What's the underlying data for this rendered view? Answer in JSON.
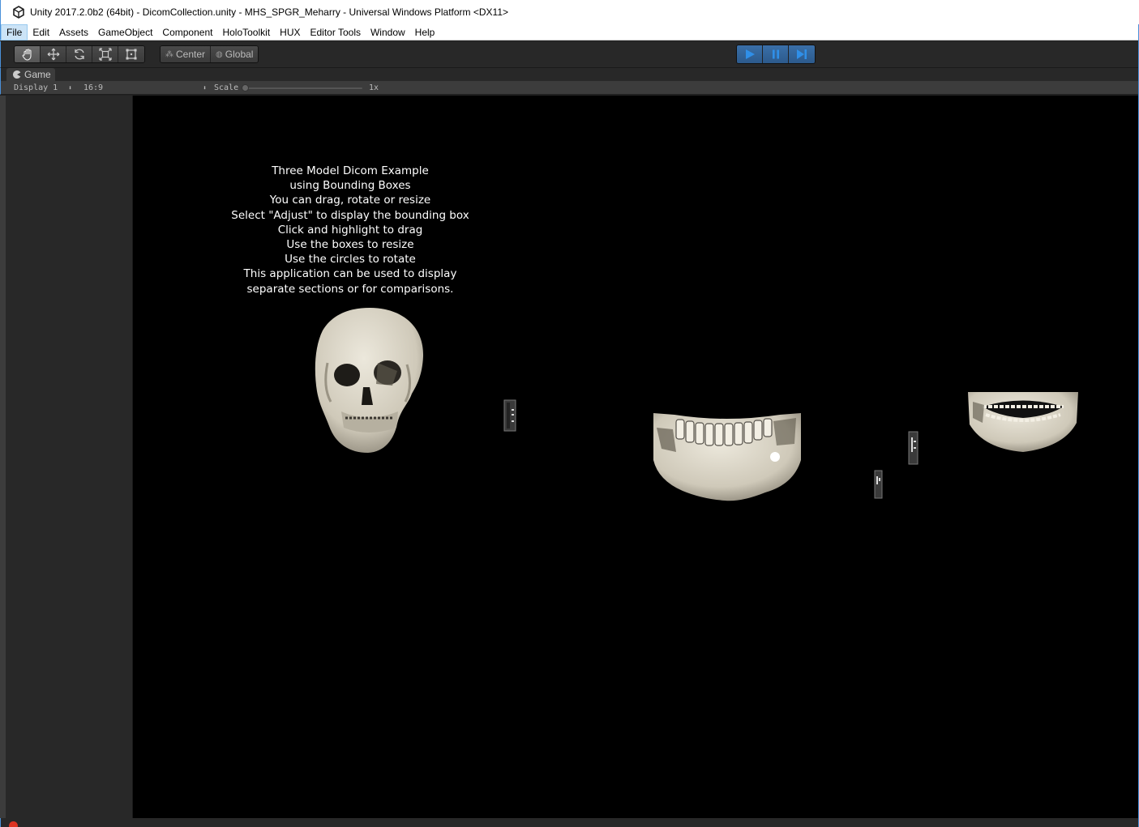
{
  "window": {
    "title": "Unity 2017.2.0b2 (64bit) - DicomCollection.unity - MHS_SPGR_Meharry - Universal Windows Platform <DX11>"
  },
  "menu": [
    {
      "label": "File",
      "active": true
    },
    {
      "label": "Edit"
    },
    {
      "label": "Assets"
    },
    {
      "label": "GameObject"
    },
    {
      "label": "Component"
    },
    {
      "label": "HoloToolkit"
    },
    {
      "label": "HUX"
    },
    {
      "label": "Editor Tools"
    },
    {
      "label": "Window"
    },
    {
      "label": "Help"
    }
  ],
  "toolbar": {
    "tools": [
      "hand-icon",
      "move-icon",
      "rotate-icon",
      "scale-icon",
      "rect-icon"
    ],
    "pivot": {
      "center_label": "Center",
      "global_label": "Global"
    },
    "playback": [
      "play-icon",
      "pause-icon",
      "step-icon"
    ]
  },
  "game": {
    "tab_label": "Game",
    "display_value": "Display 1",
    "aspect_value": "16:9",
    "scale_label": "Scale",
    "scale_value": "1x",
    "instructions": [
      "Three Model Dicom Example",
      "using Bounding Boxes",
      "You can drag, rotate or resize",
      "Select \"Adjust\" to display the bounding box",
      "Click and highlight to drag",
      "Use the boxes to resize",
      "Use the circles to rotate",
      "This application can be used to display",
      "separate sections or for comparisons."
    ]
  },
  "status": {
    "message": ""
  },
  "colors": {
    "play_active": "#3a6fa8",
    "viewport_bg": "#000000",
    "bone": "#d6d1c4",
    "error": "#dd3322"
  }
}
